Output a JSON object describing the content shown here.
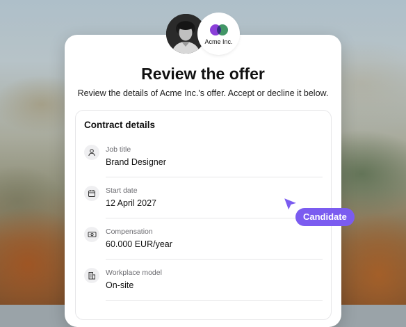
{
  "header": {
    "company_name": "Acme Inc.",
    "title": "Review the offer",
    "subtitle": "Review the details of Acme Inc.'s offer. Accept or decline it below."
  },
  "contract": {
    "heading": "Contract details",
    "items": [
      {
        "label": "Job title",
        "value": "Brand Designer",
        "icon": "person-icon"
      },
      {
        "label": "Start date",
        "value": "12 April 2027",
        "icon": "calendar-icon"
      },
      {
        "label": "Compensation",
        "value": "60.000 EUR/year",
        "icon": "money-icon"
      },
      {
        "label": "Workplace model",
        "value": "On-site",
        "icon": "building-icon"
      }
    ]
  },
  "cursor_tag": {
    "label": "Candidate"
  },
  "colors": {
    "accent": "#7b5cf0",
    "logo_purple": "#8b3fd9",
    "logo_green": "#2e8b57"
  }
}
